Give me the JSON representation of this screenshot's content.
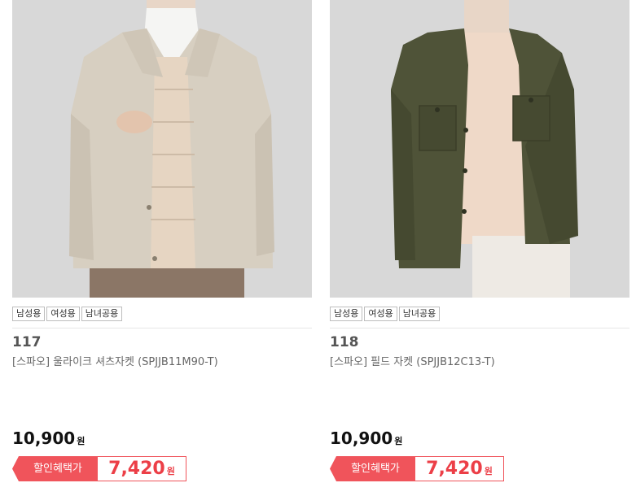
{
  "products": [
    {
      "image_alt": "wool-like shirt jacket model photo",
      "tags": [
        "남성용",
        "여성용",
        "남녀공용"
      ],
      "number": "117",
      "title": "[스파오] 울라이크 셔츠자켓 (SPJJB11M90-T)",
      "price": "10,900",
      "price_unit": "원",
      "sale_label": "할인혜택가",
      "sale_price": "7,420",
      "sale_unit": "원"
    },
    {
      "image_alt": "field jacket model photo",
      "tags": [
        "남성용",
        "여성용",
        "남녀공용"
      ],
      "number": "118",
      "title": "[스파오] 필드 자켓 (SPJJB12C13-T)",
      "price": "10,900",
      "price_unit": "원",
      "sale_label": "할인혜택가",
      "sale_price": "7,420",
      "sale_unit": "원"
    }
  ],
  "colors": {
    "sale_accent": "#f0545b",
    "jacket_1": "#d7cfc1",
    "jacket_2": "#4f5338"
  }
}
